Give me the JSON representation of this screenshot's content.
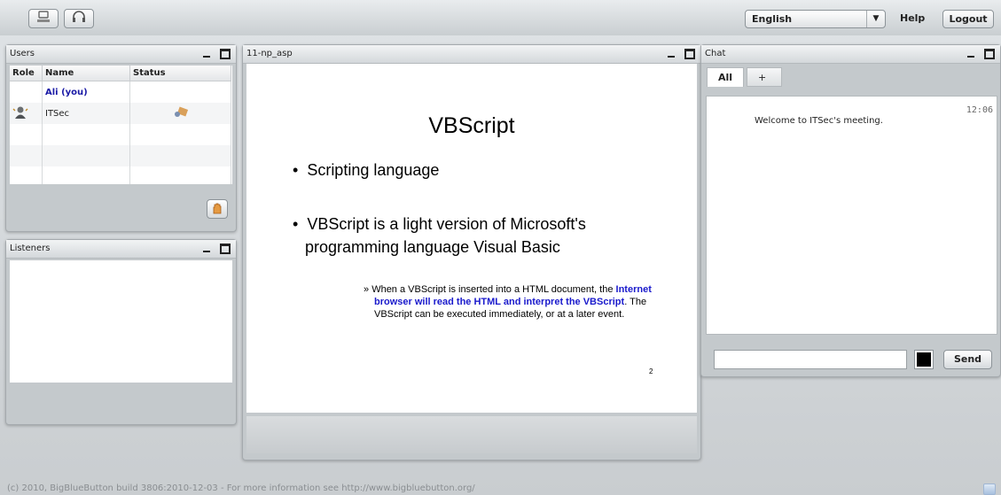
{
  "topbar": {
    "webcam_icon": "webcam-icon",
    "headset_icon": "headset-icon",
    "language": "English",
    "help": "Help",
    "logout": "Logout"
  },
  "users": {
    "title": "Users",
    "columns": [
      "Role",
      "Name",
      "Status"
    ],
    "rows": [
      {
        "name": "Ali (you)",
        "role_icon": "",
        "status_icon": ""
      },
      {
        "name": "ITSec",
        "role_icon": "presenter-icon",
        "status_icon": "presenter-status-icon"
      }
    ],
    "raise_hand_icon": "raise-hand-icon"
  },
  "listeners": {
    "title": "Listeners"
  },
  "presentation": {
    "title": "11-np_asp",
    "slide": {
      "heading": "VBScript",
      "bullet1": "Scripting language",
      "bullet2": "VBScript is a light version of Microsoft's programming language Visual Basic",
      "sub_prefix": "When a VBScript is inserted into a HTML document, the ",
      "sub_highlight": "Internet browser will read the HTML and interpret the VBScript",
      "sub_suffix": ". The VBScript can be executed immediately, or at a later event.",
      "page_number": "2"
    }
  },
  "chat": {
    "title": "Chat",
    "tabs": [
      "All",
      "+"
    ],
    "message": "Welcome to ITSec's meeting.",
    "time": "12:06",
    "input_value": "",
    "send": "Send"
  },
  "footer": {
    "text": "(c) 2010, BigBlueButton build 3806:2010-12-03 - For more information see http://www.bigbluebutton.org/"
  },
  "colors": {
    "highlight": "#1a1acc",
    "name_blue": "#1a1aa6"
  }
}
